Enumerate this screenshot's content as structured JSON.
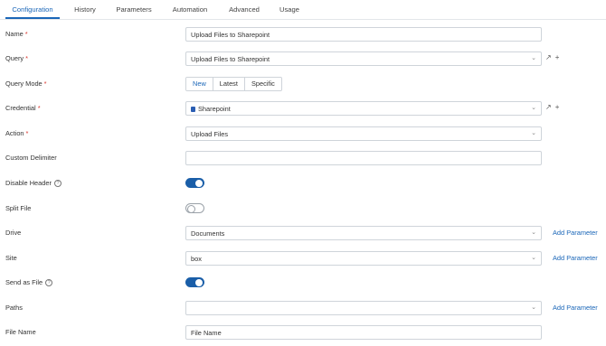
{
  "tabs": [
    {
      "label": "Configuration"
    },
    {
      "label": "History"
    },
    {
      "label": "Parameters"
    },
    {
      "label": "Automation"
    },
    {
      "label": "Advanced"
    },
    {
      "label": "Usage"
    }
  ],
  "form": {
    "name": {
      "label": "Name",
      "required": "*",
      "value": "Upload Files to Sharepoint"
    },
    "query": {
      "label": "Query",
      "required": "*",
      "value": "Upload Files to Sharepoint"
    },
    "query_mode": {
      "label": "Query Mode",
      "required": "*",
      "options": [
        "New",
        "Latest",
        "Specific"
      ],
      "selected": "New"
    },
    "credential": {
      "label": "Credential",
      "required": "*",
      "value": "Sharepoint"
    },
    "action": {
      "label": "Action",
      "required": "*",
      "value": "Upload Files"
    },
    "custom_delimiter": {
      "label": "Custom Delimiter",
      "value": ""
    },
    "disable_header": {
      "label": "Disable Header",
      "help": "?",
      "on": true
    },
    "split_file": {
      "label": "Split File",
      "on": false
    },
    "drive": {
      "label": "Drive",
      "value": "Documents",
      "add_param": "Add Parameter"
    },
    "site": {
      "label": "Site",
      "value": "box",
      "add_param": "Add Parameter"
    },
    "send_as_file": {
      "label": "Send as File",
      "help": "?",
      "on": true
    },
    "paths": {
      "label": "Paths",
      "value": "",
      "add_param": "Add Parameter"
    },
    "file_name": {
      "label": "File Name",
      "value": "File Name"
    }
  },
  "icons": {
    "external": "external-link-icon",
    "add": "plus-icon",
    "chevron": "chevron-down-icon"
  },
  "colors": {
    "accent": "#1a66b8",
    "required": "#d9342b",
    "toggle_on": "#1a5ea8"
  }
}
